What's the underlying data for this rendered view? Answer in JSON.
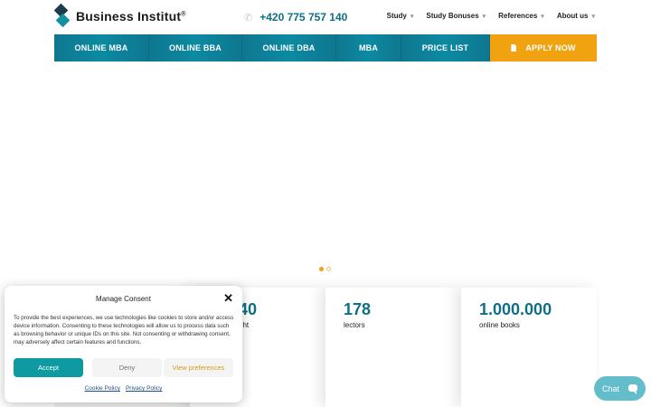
{
  "header": {
    "logo_text": "Business Institut",
    "logo_reg": "®",
    "phone": "+420 775 757 140",
    "nav": [
      {
        "label": "Study"
      },
      {
        "label": "Study Bonuses"
      },
      {
        "label": "References"
      },
      {
        "label": "About us"
      }
    ]
  },
  "menu": [
    {
      "label": "ONLINE MBA"
    },
    {
      "label": "ONLINE BBA"
    },
    {
      "label": "ONLINE DBA"
    },
    {
      "label": "MBA"
    },
    {
      "label": "PRICE LIST"
    },
    {
      "label": "APPLY NOW"
    }
  ],
  "slider": {
    "dots": 2,
    "active_index": 0
  },
  "stats": [
    {
      "value": "40",
      "label": "ght"
    },
    {
      "value": "178",
      "label": "lectors"
    },
    {
      "value": "1.000.000",
      "label": "online books"
    }
  ],
  "consent": {
    "title": "Manage Consent",
    "text": "To provide the best experiences, we use technologies like cookies to store and/or access device information. Consenting to these technologies will allow us to process data such as browsing behavior or unique IDs on this site. Not consenting or withdrawing consent, may adversely affect certain features and functions.",
    "accept": "Accept",
    "deny": "Deny",
    "preferences": "View preferences",
    "cookie_policy": "Cookie Policy",
    "privacy_policy": "Privacy Policy"
  },
  "chat": {
    "label": "Chat"
  },
  "colors": {
    "primary": "#0f7790",
    "accent": "#f0a211",
    "accept": "#0e9aa0"
  }
}
